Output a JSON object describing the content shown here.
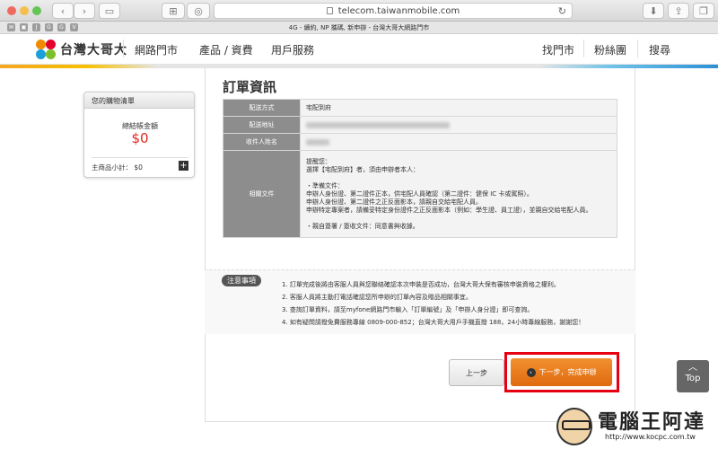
{
  "browser": {
    "url": "telecom.taiwanmobile.com",
    "tab_title": "4G - 續約, NP 攜碼, 新申辦 - 台灣大哥大網路門市",
    "bookmark_icons": [
      "J",
      "G",
      "G",
      "V"
    ]
  },
  "header": {
    "logo_text": "台灣大哥大",
    "nav_left": [
      "網路門市",
      "產品 / 資費",
      "用戶服務"
    ],
    "nav_right": [
      "找門市",
      "粉絲團",
      "搜尋"
    ]
  },
  "cart": {
    "title": "您的購物清單",
    "total_label": "總結帳金額",
    "total_value": "$0",
    "subtotal_label": "主商品小計： $0",
    "add_symbol": "+"
  },
  "order": {
    "title": "訂單資訊",
    "rows": [
      {
        "label": "配送方式",
        "value": "宅配到府"
      },
      {
        "label": "配送地址",
        "value": ""
      },
      {
        "label": "收件人姓名",
        "value": ""
      }
    ],
    "docs_label": "相關文件",
    "docs_lines": [
      "提醒您：",
      "選擇【宅配到府】者，須由申辦者本人：",
      "",
      "・準備文件：",
      "申辦人身份證、第二證件正本，供宅配人員確認（第二證件：健保 IC 卡或駕照）。",
      "申辦人身份證、第二證件之正反面影本，請親自交給宅配人員。",
      "申辦特定專案者，請備妥特定身份證件之正反面影本（例如：學生證、員工證），並親自交給宅配人員。",
      "",
      "・親自簽署 / 簽收文件：同意書與收據。"
    ]
  },
  "notes": {
    "tag": "注意事項",
    "items": [
      "1.  訂單完成後將由客服人員與您聯絡確認本次申裝是否成功，台灣大哥大保有審核申裝資格之權利。",
      "2.  客服人員將主動打電話確認您所申辦的訂單內容及贈品相關事宜。",
      "3.  查詢訂單資料，請至myfone網路門市輸入「訂單編號」及「申辦人身分證」即可查詢。",
      "4.  如有疑問請撥免費服務專線 0809-000-852；台灣大哥大用戶手機直撥 188，24小時專線服務，謝謝您！"
    ]
  },
  "actions": {
    "prev_label": "上一步",
    "next_label": "下一步，完成申辦",
    "top_label": "Top"
  },
  "watermark": {
    "title": "電腦王阿達",
    "url": "http://www.kocpc.com.tw"
  },
  "colors": {
    "accent": "#e06a10",
    "highlight": "#e60012",
    "price": "#e0261c"
  }
}
